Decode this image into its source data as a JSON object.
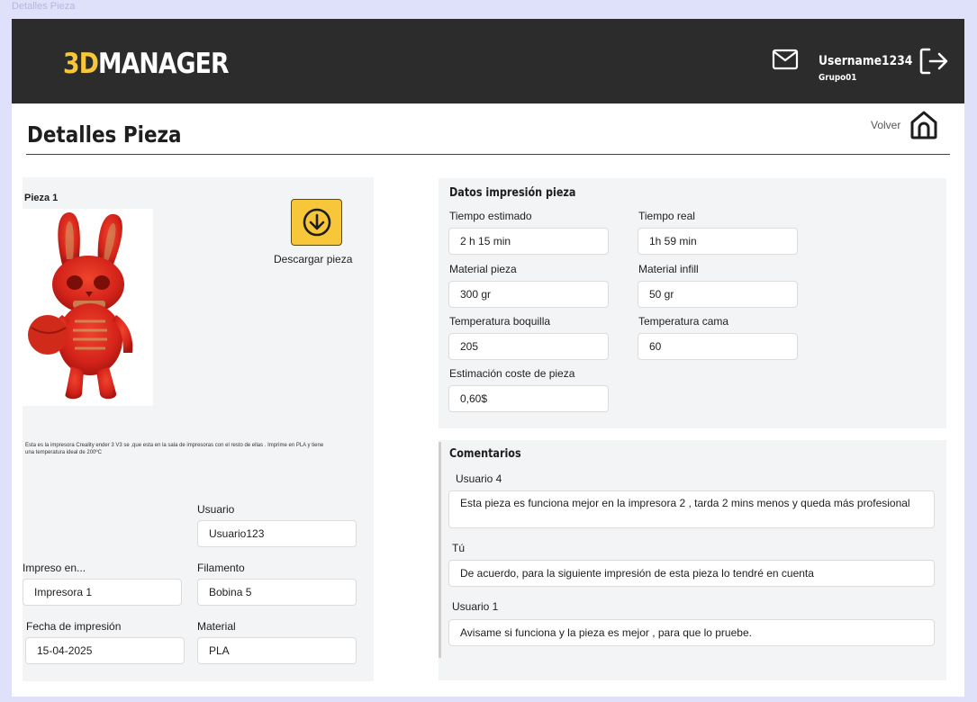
{
  "window": {
    "title": "Detalles Pieza"
  },
  "header": {
    "logo_accent": "3D",
    "logo_rest": "MANAGER",
    "username": "Username1234",
    "group": "Grupo01",
    "icons": {
      "mail": "mail-icon",
      "logout": "logout-icon"
    }
  },
  "page": {
    "title": "Detalles  Pieza",
    "back_label": "Volver",
    "home_icon": "home-icon"
  },
  "piece": {
    "name": "Pieza 1",
    "download_label": "Descargar pieza",
    "download_icon": "download-arrow-icon",
    "description": "Esta es la impresora Creality ender 3 V3 se ,que esta en la sala de impresoras con el resto de ellas . Imprime en PLA y tiene una temperatura ideal de 200ºC",
    "fields": {
      "usuario_label": "Usuario",
      "usuario_value": "Usuario123",
      "impreso_label": "Impreso en...",
      "impreso_value": "Impresora 1",
      "filamento_label": "Filamento",
      "filamento_value": "Bobina 5",
      "fecha_label": "Fecha de impresión",
      "fecha_value": "15-04-2025",
      "material_label": "Material",
      "material_value": "PLA"
    }
  },
  "print_data": {
    "title": "Datos impresión pieza",
    "tiempo_estimado_label": "Tiempo estimado",
    "tiempo_estimado_value": "2 h 15 min",
    "tiempo_real_label": "Tiempo real",
    "tiempo_real_value": "1h 59 min",
    "material_pieza_label": "Material pieza",
    "material_pieza_value": "300 gr",
    "material_infill_label": "Material infill",
    "material_infill_value": "50 gr",
    "temp_boquilla_label": "Temperatura boquilla",
    "temp_boquilla_value": "205",
    "temp_cama_label": "Temperatura cama",
    "temp_cama_value": "60",
    "coste_label": "Estimación coste de pieza",
    "coste_value": "0,60$"
  },
  "comments": {
    "title": "Comentarios",
    "items": [
      {
        "author": "Usuario 4",
        "text": " Esta pieza es funciona mejor en la impresora 2 , tarda 2 mins menos y queda más profesional"
      },
      {
        "author": "Tú",
        "text": "De acuerdo, para la siguiente impresión de esta pieza lo tendré en cuenta"
      },
      {
        "author": "Usuario 1",
        "text": "Avisame si funciona y la pieza es  mejor , para que lo pruebe."
      }
    ]
  },
  "colors": {
    "accent": "#f7c739",
    "topbar": "#2c2c2c",
    "background": "#dfe1fb",
    "panel": "#f3f4f6",
    "piece_red": "#d8261c"
  }
}
